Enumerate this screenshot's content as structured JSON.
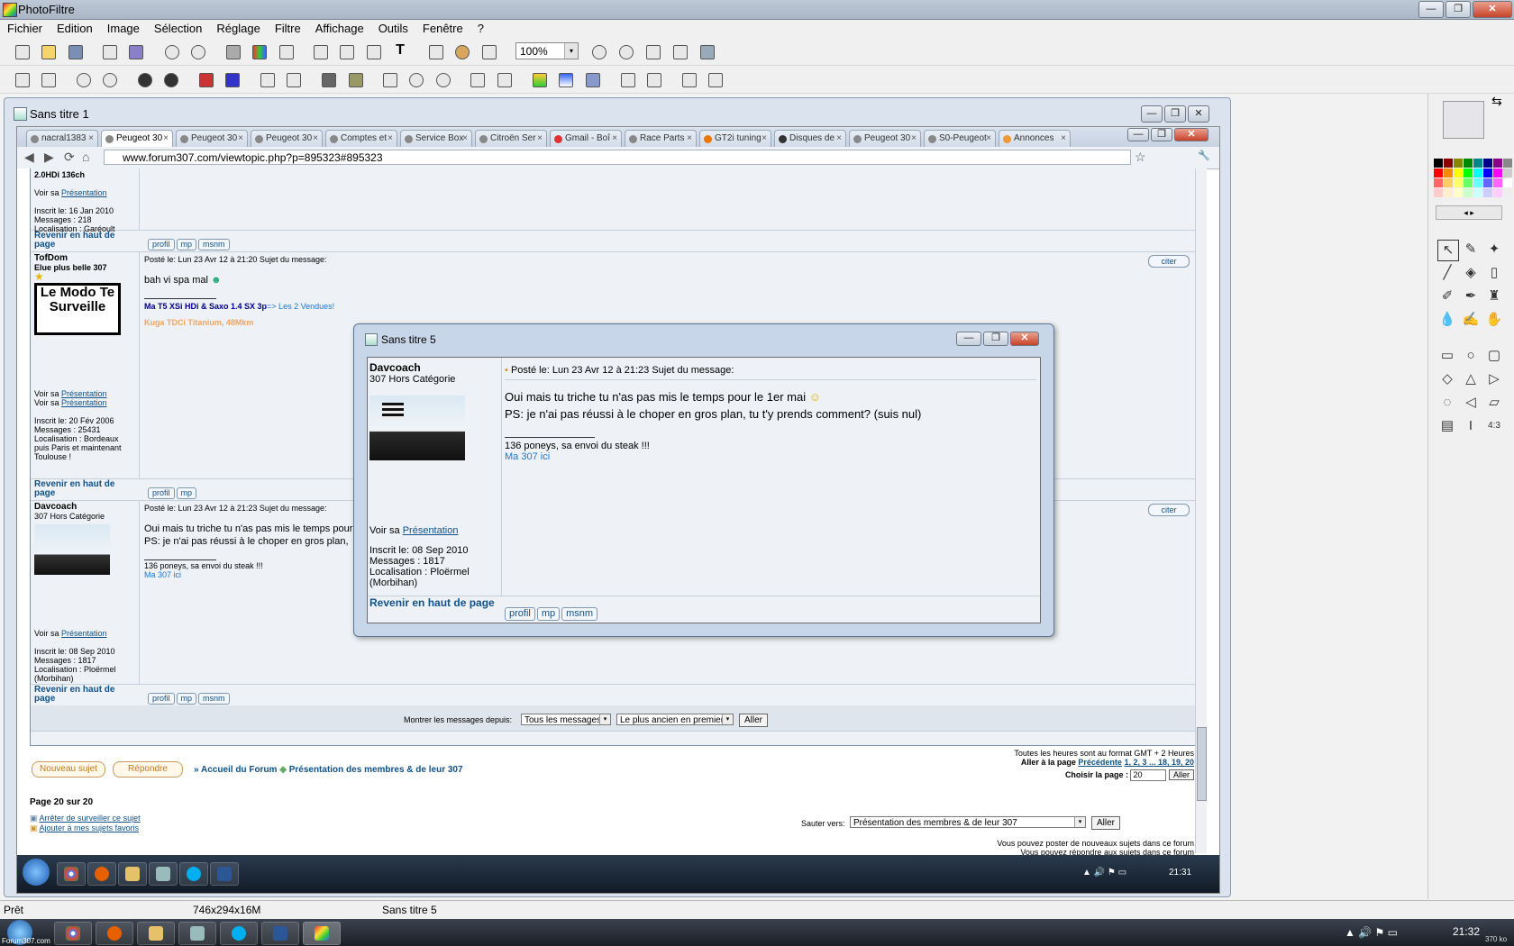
{
  "app": {
    "title": "PhotoFiltre"
  },
  "menu": [
    "Fichier",
    "Edition",
    "Image",
    "Sélection",
    "Réglage",
    "Filtre",
    "Affichage",
    "Outils",
    "Fenêtre",
    "?"
  ],
  "toolbar": {
    "zoom": "100%",
    "zoom_arrow": "▾"
  },
  "win_buttons": {
    "min": "—",
    "max": "❐",
    "close": "✕"
  },
  "document": {
    "title": "Sans titre 1"
  },
  "browser": {
    "url": "www.forum307.com/viewtopic.php?p=895323#895323",
    "tabs": [
      "nacral1383",
      "Peugeot 30",
      "Peugeot 30",
      "Peugeot 30",
      "Comptes et",
      "Service Box",
      "Citroën Ser",
      "Gmail - Boî",
      "Race Parts",
      "GT2i tuning",
      "Disques de",
      "Peugeot 30",
      "S0-Peugeot",
      "Annonces"
    ],
    "tab_close": "×",
    "nav": {
      "back": "◀",
      "forward": "▶",
      "reload": "⟳",
      "home": "⌂",
      "star": "☆",
      "wrench": "🔧"
    }
  },
  "forum": {
    "post1": {
      "car": "2.0HDi 136ch",
      "voir": "Voir sa",
      "presentation": "Présentation",
      "inscrit": "Inscrit le: 16 Jan 2010",
      "messages": "Messages : 218",
      "loc": "Localisation : Garéoult"
    },
    "revenir": "Revenir en haut de page",
    "btn_profil": "profil",
    "btn_mp": "mp",
    "btn_msnm": "msnm",
    "citer": "citer",
    "post2": {
      "author": "TofDom",
      "rank": "Elue plus belle 307",
      "avatar_text": "Le Modo Te Surveille",
      "date": "Posté le: Lun 23 Avr 12 à 21:20    Sujet du message:",
      "body": "bah vi spa mal",
      "sig1a": "Ma T5 XSi HDi & Saxo 1.4 SX 3p",
      "sig1b": "=> Les 2 Vendues!",
      "sig2a": "Kuga TDCi",
      "sig2b": "Titanium, 48Mkm",
      "voir1": "Voir sa",
      "pres1": "Présentation",
      "voir2": "Voir sa",
      "pres2": "Présentation",
      "inscrit": "Inscrit le: 20 Fév 2006",
      "messages": "Messages : 25431",
      "loc": "Localisation : Bordeaux puis Paris et maintenant Toulouse !"
    },
    "post3": {
      "author": "Davcoach",
      "rank": "307 Hors Catégorie",
      "date": "Posté le: Lun 23 Avr 12 à 21:23    Sujet du message:",
      "body1": "Oui mais tu triche tu n'as pas mis le temps pour",
      "body2": "PS: je n'ai pas réussi à le choper en gros plan,",
      "sig1": "136 poneys, sa envoi du steak !!!",
      "sig2": "Ma 307 ici",
      "voir": "Voir sa",
      "presentation": "Présentation",
      "inscrit": "Inscrit le: 08 Sep 2010",
      "messages": "Messages : 1817",
      "loc": "Localisation : Ploërmel (Morbihan)"
    },
    "show_since": "Montrer les messages depuis:",
    "sel_msgs": "Tous les messages",
    "sel_order": "Le plus ancien en premier",
    "sel_arrow": "▾",
    "aller": "Aller",
    "nouveau": "Nouveau sujet",
    "repondre": "Répondre",
    "crumb_pre": "»",
    "crumb1": "Accueil du Forum",
    "crumb_sep": "◆",
    "crumb2": "Présentation des membres & de leur 307",
    "gmt": "Toutes les heures sont au format GMT + 2 Heures",
    "goto_label": "Aller à la page",
    "goto_prev": "Précédente",
    "goto_pages": "1, 2, 3 ... 18, 19, 20",
    "choose_page": "Choisir la page :",
    "page_val": "20",
    "page_of": "Page 20 sur 20",
    "stop_watch": "Arrêter de surveiller ce sujet",
    "add_fav": "Ajouter à mes sujets favoris",
    "jump": "Sauter vers:",
    "jump_val": "Présentation des membres & de leur 307",
    "perm1": "Vous pouvez poster de nouveaux sujets dans ce forum",
    "perm2": "Vous pouvez répondre aux sujets dans ce forum"
  },
  "dialog": {
    "title": "Sans titre 5",
    "author": "Davcoach",
    "rank": "307 Hors Catégorie",
    "date": "Posté le: Lun 23 Avr 12 à 21:23    Sujet du message:",
    "body1": "Oui mais tu triche tu n'as pas mis le temps pour le 1er mai",
    "body2": "PS: je n'ai pas réussi à le choper en gros plan, tu t'y prends comment? (suis nul)",
    "sig1": "136 poneys, sa envoi du steak !!!",
    "sig2": "Ma 307 ici",
    "voir": "Voir sa",
    "presentation": "Présentation",
    "inscrit": "Inscrit le: 08 Sep 2010",
    "messages": "Messages : 1817",
    "loc": "Localisation : Ploërmel (Morbihan)",
    "revenir": "Revenir en haut de page",
    "profil": "profil",
    "mp": "mp",
    "msnm": "msnm"
  },
  "inner_taskbar": {
    "time": "21:31",
    "tray": "▲ 🔊 ⚑ ▭"
  },
  "status": {
    "ready": "Prêt",
    "size": "746x294x16M",
    "name": "Sans titre 5"
  },
  "taskbar": {
    "time": "21:32",
    "corner": "Forum307.com",
    "tray": "▲ 🔊 ⚑ ▭",
    "mini": "370 ko"
  }
}
